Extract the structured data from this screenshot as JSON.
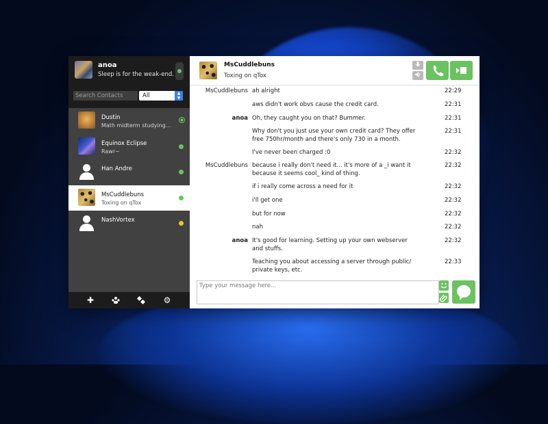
{
  "profile": {
    "name": "anoa",
    "status": "Sleep is for the weak-end."
  },
  "search": {
    "placeholder": "Search Contacts",
    "filter": "All"
  },
  "contacts": [
    {
      "name": "Dustin",
      "status": "Math midterm studying...",
      "avatar": "cat-avatar",
      "presence": "online-ring"
    },
    {
      "name": "Equinox Eclipse",
      "status": "Rawr~",
      "avatar": "eclipse-avatar",
      "presence": "online"
    },
    {
      "name": "Han Andre",
      "status": "",
      "avatar": "default-avatar",
      "presence": "online"
    },
    {
      "name": "MsCuddlebuns",
      "status": "Toxing on qTox",
      "avatar": "cookies-avatar",
      "presence": "online",
      "selected": true
    },
    {
      "name": "NashVortex",
      "status": "",
      "avatar": "default-avatar",
      "presence": "away"
    }
  ],
  "chat": {
    "name": "MsCuddlebuns",
    "status": "Toxing on qTox"
  },
  "messages": [
    {
      "author": "MsCuddlebuns",
      "text": "ah alright",
      "time": "22:29"
    },
    {
      "author": "",
      "text": "aws didn't work obvs cause the credit card.",
      "time": "22:31"
    },
    {
      "author": "anoa",
      "text": "Oh, they caught you on that? Bummer.",
      "time": "22:31"
    },
    {
      "author": "",
      "text": "Why don't you just use your own credit card? They offer free 750hr/month and there's only 730 in a month.",
      "time": "22:31"
    },
    {
      "author": "",
      "text": "I've never been charged :0",
      "time": "22:32"
    },
    {
      "author": "MsCuddlebuns",
      "text": "because i really don't need it... it's more of a _i want it because it seems cool_ kind of thing.",
      "time": "22:32"
    },
    {
      "author": "",
      "text": "if i really come across a need for it",
      "time": "22:32"
    },
    {
      "author": "",
      "text": "i'll get one",
      "time": "22:32"
    },
    {
      "author": "",
      "text": "but for now",
      "time": "22:32"
    },
    {
      "author": "",
      "text": "nah",
      "time": "22:32"
    },
    {
      "author": "anoa",
      "text": "It's good for learning. Setting up your own webserver and stuffs.",
      "time": "22:32"
    },
    {
      "author": "",
      "text": "Teaching you about accessing a server through public/ private keys, etc.",
      "time": "22:33"
    }
  ],
  "composer": {
    "placeholder": "Type your message here..."
  },
  "colors": {
    "accent": "#6bc260",
    "sidebar": "#414141",
    "sidebar_dark": "#1c1c1c",
    "away": "#e7c63a"
  },
  "icons": {
    "bottom": [
      "add-friend-icon",
      "group-chat-icon",
      "file-transfer-icon",
      "settings-icon"
    ],
    "header": [
      "microphone-icon",
      "volume-icon",
      "phone-icon",
      "video-icon"
    ],
    "composer": [
      "emoji-icon",
      "attachment-icon",
      "send-icon"
    ]
  }
}
